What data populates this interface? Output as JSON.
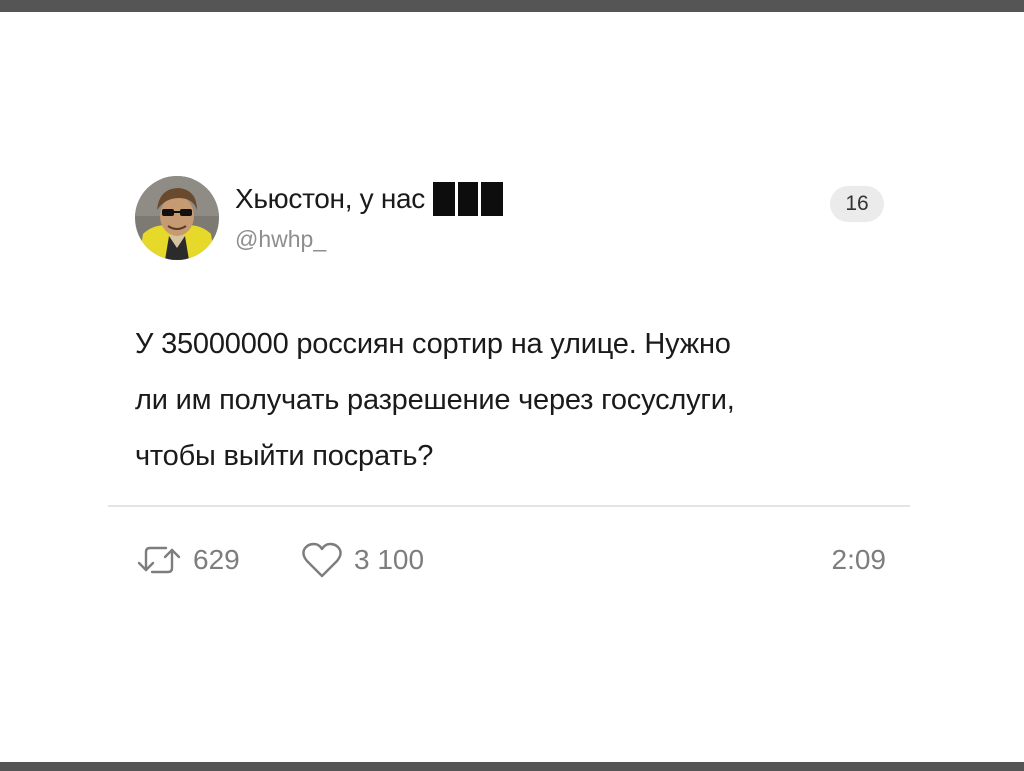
{
  "post": {
    "author": {
      "display_name": "Хьюстон, у нас",
      "handle": "@hwhp_",
      "avatar_icon": "user-avatar-photo"
    },
    "badge_count": "16",
    "text": "У 35000000 россиян сортир на улице. Нужно\nли им получать разрешение через госуслуги,\nчтобы выйти посрать?",
    "stats": {
      "retweets": "629",
      "likes": "3 100"
    },
    "time": "2:09"
  },
  "colors": {
    "text": "#1a1a1a",
    "muted": "#7d7d7d",
    "badge_bg": "#ebebeb",
    "frame": "#555555"
  }
}
